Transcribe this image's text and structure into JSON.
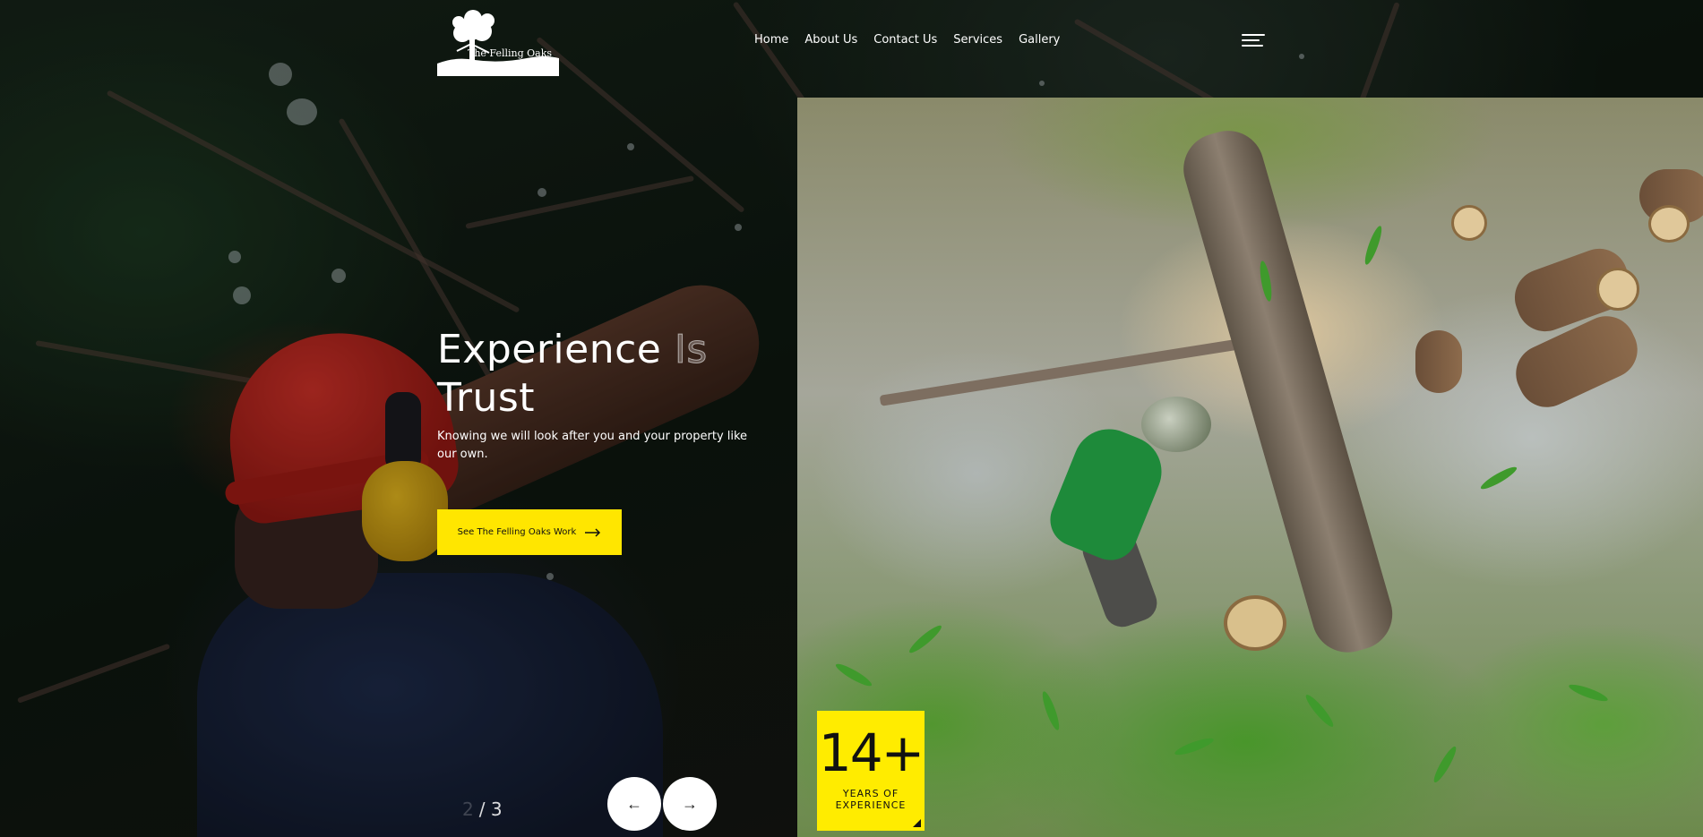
{
  "brand": {
    "logo_text": "The Felling Oaks",
    "logo_icon": "oak-tree-icon"
  },
  "nav": {
    "items": [
      {
        "label": "Home"
      },
      {
        "label": "About Us"
      },
      {
        "label": "Contact Us"
      },
      {
        "label": "Services"
      },
      {
        "label": "Gallery"
      }
    ],
    "menu_icon": "hamburger-menu-icon"
  },
  "hero": {
    "title_word1": "Experience",
    "title_word2": "Is",
    "title_word3": "Trust",
    "subtitle": "Knowing we will look after you and your property like our own.",
    "cta_label": "See The Felling Oaks Work",
    "cta_icon": "long-arrow-right-icon"
  },
  "slider": {
    "current": "2",
    "separator": "/",
    "total": "3",
    "prev_icon": "arrow-left-icon",
    "next_icon": "arrow-right-icon",
    "prev_glyph": "←",
    "next_glyph": "→"
  },
  "badge": {
    "number": "14+",
    "label_line1": "YEARS OF",
    "label_line2": "EXPERIENCE"
  },
  "colors": {
    "accent": "#ffe600",
    "text": "#ffffff",
    "button_text": "#111111"
  }
}
